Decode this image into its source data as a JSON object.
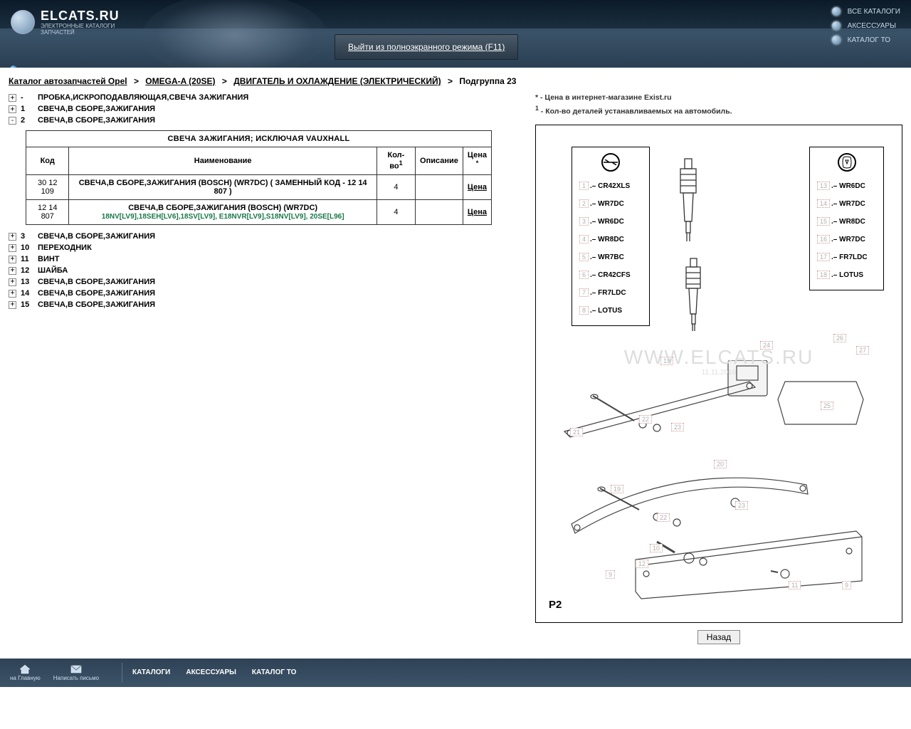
{
  "header": {
    "logo_main": "ELCATS.RU",
    "logo_sub1": "ЭЛЕКТРОННЫЕ КАТАЛОГИ",
    "logo_sub2": "ЗАПЧАСТЕЙ",
    "fullscreen_btn": "Выйти из полноэкранного режима (F11)",
    "nav": [
      "ВСЕ КАТАЛОГИ",
      "АКСЕССУАРЫ",
      "КАТАЛОГ ТО"
    ]
  },
  "breadcrumb": {
    "items": [
      {
        "label": "Каталог автозапчастей Opel",
        "link": true
      },
      {
        "label": "OMEGA-A (20SE)",
        "link": true
      },
      {
        "label": "ДВИГАТЕЛЬ И ОХЛАЖДЕНИЕ (ЭЛЕКТРИЧЕСКИЙ)",
        "link": true
      }
    ],
    "current": "Подгруппа 23"
  },
  "tree": [
    {
      "num": "-",
      "label": "ПРОБКА,ИСКРОПОДАВЛЯЮЩАЯ,СВЕЧА ЗАЖИГАНИЯ",
      "expanded": false
    },
    {
      "num": "1",
      "label": "СВЕЧА,В СБОРЕ,ЗАЖИГАНИЯ",
      "expanded": false
    },
    {
      "num": "2",
      "label": "СВЕЧА,В СБОРЕ,ЗАЖИГАНИЯ",
      "expanded": true
    },
    {
      "num": "3",
      "label": "СВЕЧА,В СБОРЕ,ЗАЖИГАНИЯ",
      "expanded": false
    },
    {
      "num": "10",
      "label": "ПЕРЕХОДНИК",
      "expanded": false
    },
    {
      "num": "11",
      "label": "ВИНТ",
      "expanded": false
    },
    {
      "num": "12",
      "label": "ШАЙБА",
      "expanded": false
    },
    {
      "num": "13",
      "label": "СВЕЧА,В СБОРЕ,ЗАЖИГАНИЯ",
      "expanded": false
    },
    {
      "num": "14",
      "label": "СВЕЧА,В СБОРЕ,ЗАЖИГАНИЯ",
      "expanded": false
    },
    {
      "num": "15",
      "label": "СВЕЧА,В СБОРЕ,ЗАЖИГАНИЯ",
      "expanded": false
    }
  ],
  "table": {
    "title": "СВЕЧА ЗАЖИГАНИЯ; ИСКЛЮЧАЯ VAUXHALL",
    "headers": {
      "code": "Код",
      "name": "Наименование",
      "qty": "Кол-во",
      "qty_sup": "1",
      "desc": "Описание",
      "price": "Цена",
      "price_sup": "*"
    },
    "rows": [
      {
        "code": "30 12 109",
        "name": "СВЕЧА,В СБОРЕ,ЗАЖИГАНИЯ (BOSCH) (WR7DC) ( ЗАМЕННЫЙ КОД - 12 14 807 )",
        "engines": "",
        "qty": "4",
        "desc": "",
        "price": "Цена"
      },
      {
        "code": "12 14 807",
        "name": "СВЕЧА,В СБОРЕ,ЗАЖИГАНИЯ (BOSCH) (WR7DC)",
        "engines": "18NV[LV9],18SEH[LV6],18SV[LV9], E18NVR[LV9],S18NV[LV9], 20SE[L96]",
        "qty": "4",
        "desc": "",
        "price": "Цена"
      }
    ]
  },
  "notes": {
    "price": "* - Цена в интернет-магазине Exist.ru",
    "qty_sup": "1",
    "qty": " - Кол-во деталей устанавливаемых на автомобиль."
  },
  "diagram": {
    "left_box": [
      {
        "n": "1",
        "v": "CR42XLS"
      },
      {
        "n": "2",
        "v": "WR7DC"
      },
      {
        "n": "3",
        "v": "WR6DC"
      },
      {
        "n": "4",
        "v": "WR8DC"
      },
      {
        "n": "5",
        "v": "WR7BC"
      },
      {
        "n": "6",
        "v": "CR42CFS"
      },
      {
        "n": "7",
        "v": "FR7LDC"
      },
      {
        "n": "8",
        "v": "LOTUS"
      }
    ],
    "right_box": [
      {
        "n": "13",
        "v": "WR6DC"
      },
      {
        "n": "14",
        "v": "WR7DC"
      },
      {
        "n": "15",
        "v": "WR8DC"
      },
      {
        "n": "16",
        "v": "WR7DC"
      },
      {
        "n": "17",
        "v": "FR7LDC"
      },
      {
        "n": "18",
        "v": "LOTUS"
      }
    ],
    "callouts": [
      "9",
      "10",
      "11",
      "12",
      "19",
      "20",
      "21",
      "22",
      "23",
      "24",
      "25",
      "26",
      "27"
    ],
    "watermark": "WWW.ELCATS.RU",
    "watermark_date": "11.11.2016",
    "p2": "P2"
  },
  "back_btn": "Назад",
  "footer": {
    "home": "на Главную",
    "mail": "Написать письмо",
    "links": [
      "КАТАЛОГИ",
      "АКСЕССУАРЫ",
      "КАТАЛОГ ТО"
    ]
  }
}
